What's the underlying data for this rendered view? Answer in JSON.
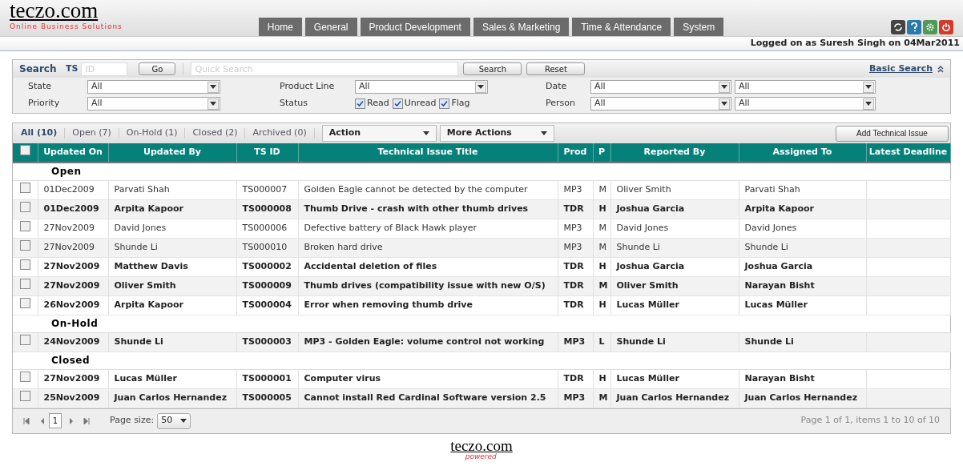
{
  "header": {
    "logo": "teczo.com",
    "tagline": "Online Business Solutions",
    "nav": [
      "Home",
      "General",
      "Product Development",
      "Sales & Marketing",
      "Time & Attendance",
      "System"
    ],
    "logged_on": "Logged on as Suresh Singh on 04Mar2011"
  },
  "search": {
    "label": "Search",
    "ts_label": "TS",
    "id_placeholder": "ID",
    "go": "Go",
    "quick_placeholder": "Quick Search",
    "search_button": "Search",
    "reset_button": "Reset",
    "basic_search": "Basic Search",
    "filters": [
      {
        "label": "State",
        "value": "All"
      },
      {
        "label": "Product Line",
        "value": "All"
      },
      {
        "label": "Date",
        "value": "All",
        "value2": "All"
      },
      {
        "label": "Priority",
        "value": "All"
      },
      {
        "label": "Status",
        "checks": [
          {
            "label": "Read",
            "checked": true
          },
          {
            "label": "Unread",
            "checked": true
          },
          {
            "label": "Flag",
            "checked": true
          }
        ]
      },
      {
        "label": "Person",
        "value": "All",
        "value2": "All"
      }
    ]
  },
  "grid": {
    "tabs": [
      {
        "label": "All (10)",
        "selected": true
      },
      {
        "label": "Open (7)",
        "selected": false
      },
      {
        "label": "On-Hold (1)",
        "selected": false
      },
      {
        "label": "Closed (2)",
        "selected": false
      },
      {
        "label": "Archived (0)",
        "selected": false
      }
    ],
    "action": "Action",
    "more_actions": "More Actions",
    "add_button": "Add Technical Issue",
    "columns": [
      "Updated On",
      "Updated By",
      "TS ID",
      "Technical Issue Title",
      "Prod",
      "P",
      "Reported By",
      "Assigned To",
      "Latest Deadline"
    ],
    "select_all_checked": false,
    "groups": [
      {
        "name": "Open",
        "rows": [
          {
            "checked": false,
            "unread": false,
            "cells": [
              "01Dec2009",
              "Parvati Shah",
              "TS000007",
              "Golden Eagle cannot be detected by the computer",
              "MP3",
              "M",
              "Oliver Smith",
              "Parvati Shah"
            ]
          },
          {
            "checked": false,
            "unread": true,
            "cells": [
              "01Dec2009",
              "Arpita Kapoor",
              "TS000008",
              "Thumb Drive - crash with other thumb drives",
              "TDR",
              "H",
              "Joshua Garcia",
              "Arpita Kapoor"
            ]
          },
          {
            "checked": false,
            "unread": false,
            "cells": [
              "27Nov2009",
              "David Jones",
              "TS000006",
              "Defective battery of Black Hawk player",
              "MP3",
              "M",
              "David Jones",
              "David Jones"
            ]
          },
          {
            "checked": false,
            "unread": false,
            "cells": [
              "27Nov2009",
              "Shunde Li",
              "TS000010",
              "Broken hard drive",
              "MP3",
              "M",
              "Shunde Li",
              "Shunde Li"
            ]
          },
          {
            "checked": false,
            "unread": true,
            "cells": [
              "27Nov2009",
              "Matthew Davis",
              "TS000002",
              "Accidental deletion of files",
              "TDR",
              "H",
              "Joshua Garcia",
              "Joshua Garcia"
            ]
          },
          {
            "checked": false,
            "unread": true,
            "cells": [
              "27Nov2009",
              "Oliver Smith",
              "TS000009",
              "Thumb drives (compatibility issue with new O/S)",
              "TDR",
              "M",
              "Oliver Smith",
              "Narayan Bisht"
            ]
          },
          {
            "checked": false,
            "unread": true,
            "cells": [
              "26Nov2009",
              "Arpita Kapoor",
              "TS000004",
              "Error when removing thumb drive",
              "TDR",
              "H",
              "Lucas Müller",
              "Lucas Müller"
            ]
          }
        ]
      },
      {
        "name": "On-Hold",
        "rows": [
          {
            "checked": false,
            "unread": true,
            "cells": [
              "24Nov2009",
              "Shunde Li",
              "TS000003",
              "MP3 - Golden Eagle: volume control not working",
              "MP3",
              "L",
              "Shunde Li",
              "Shunde Li"
            ]
          }
        ]
      },
      {
        "name": "Closed",
        "rows": [
          {
            "checked": false,
            "unread": true,
            "cells": [
              "27Nov2009",
              "Lucas Müller",
              "TS000001",
              "Computer virus",
              "TDR",
              "H",
              "Lucas Müller",
              "Narayan Bisht"
            ]
          },
          {
            "checked": false,
            "unread": true,
            "cells": [
              "25Nov2009",
              "Juan Carlos Hernandez",
              "TS000005",
              "Cannot install Red Cardinal Software version 2.5",
              "MP3",
              "M",
              "Juan Carlos Hernandez",
              "Juan Carlos Hernandez"
            ]
          }
        ]
      }
    ],
    "pager": {
      "page": "1",
      "page_size_label": "Page size:",
      "page_size": "50",
      "summary": "Page 1 of 1, items 1 to 10 of 10"
    }
  },
  "footer": {
    "logo": "teczo.com",
    "tagline": "powered"
  }
}
